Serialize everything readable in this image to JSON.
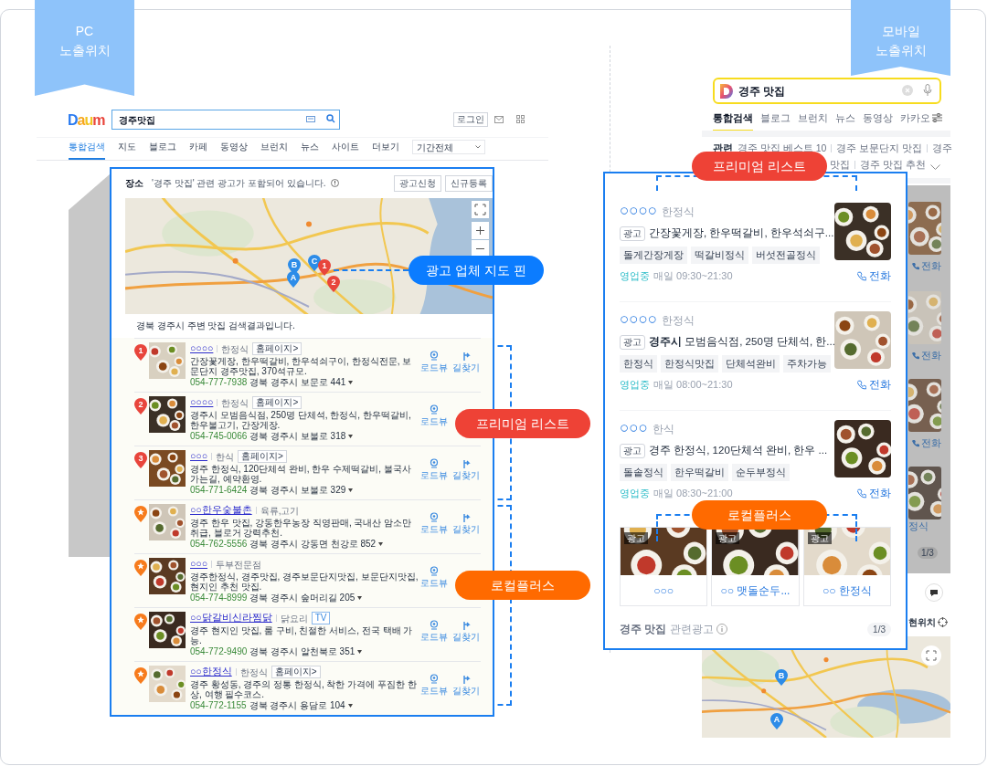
{
  "ribbons": [
    {
      "lines": [
        "PC",
        "노출위치"
      ]
    },
    {
      "lines": [
        "모바일",
        "노출위치"
      ]
    }
  ],
  "pc": {
    "logo": "Daum",
    "search": {
      "value": "경주맛집"
    },
    "login": "로그인",
    "tabs": [
      {
        "label": "통합검색",
        "selected": true
      },
      {
        "label": "지도",
        "selected": false
      },
      {
        "label": "블로그",
        "selected": false
      },
      {
        "label": "카페",
        "selected": false
      },
      {
        "label": "동영상",
        "selected": false
      },
      {
        "label": "브런치",
        "selected": false
      },
      {
        "label": "뉴스",
        "selected": false
      },
      {
        "label": "사이트",
        "selected": false
      },
      {
        "label": "더보기",
        "selected": false
      }
    ],
    "period": "기간전체",
    "place_panel": {
      "title": "장소",
      "notice": "'경주 맛집' 관련 광고가 포함되어 있습니다.",
      "buttons": [
        "광고신청",
        "신규등록"
      ],
      "map": {
        "pins": [
          {
            "label": "B",
            "kind": "ad"
          },
          {
            "label": "A",
            "kind": "ad"
          },
          {
            "label": "C",
            "kind": "ad"
          },
          {
            "label": "1",
            "kind": "premium"
          },
          {
            "label": "2",
            "kind": "premium"
          }
        ]
      },
      "summary": "경북 경주시 주변 맛집 검색결과입니다.",
      "results": [
        {
          "kind": "premium",
          "marker": "1",
          "name": "○○○○",
          "category": "한정식",
          "badge": {
            "kind": "homepage",
            "text": "홈페이지>"
          },
          "description": "간장꽃게장, 한우떡갈비, 한우석쇠구이, 한정식전문, 보문단지 경주맛집, 370석규모.",
          "phone": "054-777-7938",
          "address": "경북 경주시 보문로 441",
          "actions": [
            {
              "kind": "roadview",
              "label": "로드뷰"
            },
            {
              "kind": "directions",
              "label": "길찾기"
            }
          ]
        },
        {
          "kind": "premium",
          "marker": "2",
          "name": "○○○○",
          "category": "한정식",
          "badge": {
            "kind": "homepage",
            "text": "홈페이지>"
          },
          "description": "경주시 모범음식점, 250명 단체석, 한정식, 한우떡갈비, 한우불고기, 간장게장.",
          "phone": "054-745-0066",
          "address": "경북 경주시 보불로 318",
          "actions": [
            {
              "kind": "roadview",
              "label": "로드뷰"
            }
          ]
        },
        {
          "kind": "premium",
          "marker": "3",
          "name": "○○○",
          "category": "한식",
          "badge": {
            "kind": "homepage",
            "text": "홈페이지>"
          },
          "description": "경주 한정식, 120단체석 완비, 한우 수제떡갈비, 불국사 가는길, 예약환영.",
          "phone": "054-771-6424",
          "address": "경북 경주시 보불로 329",
          "actions": [
            {
              "kind": "roadview",
              "label": "로드뷰"
            },
            {
              "kind": "directions",
              "label": "길찾기"
            }
          ]
        },
        {
          "kind": "local",
          "name": "○○한우숯불촌",
          "category": "육류,고기",
          "description": "경주 한우 맛집, 강동한우농장 직영판매, 국내산 암소만 취급, 블로거 강력추천.",
          "phone": "054-762-5556",
          "address": "경북 경주시 강동면 천강로 852",
          "actions": [
            {
              "kind": "roadview",
              "label": "로드뷰"
            },
            {
              "kind": "directions",
              "label": "길찾기"
            }
          ]
        },
        {
          "kind": "local",
          "name": "○○○",
          "category": "두부전문점",
          "description": "경주한정식, 경주맛집, 경주보문단지맛집, 보문단지맛집, 현지인 추천 맛집.",
          "phone": "054-774-8999",
          "address": "경북 경주시 숲머리길 205",
          "actions": [
            {
              "kind": "roadview",
              "label": "로드뷰"
            }
          ]
        },
        {
          "kind": "local",
          "name": "○○닭갈비신라찜닭",
          "category": "닭요리",
          "badge": {
            "kind": "tv",
            "text": "TV"
          },
          "description": "경주 현지인 맛집, 룸 구비, 친절한 서비스, 전국 택배 가능.",
          "phone": "054-772-9490",
          "address": "경북 경주시 알천북로 351",
          "actions": [
            {
              "kind": "roadview",
              "label": "로드뷰"
            },
            {
              "kind": "directions",
              "label": "길찾기"
            }
          ]
        },
        {
          "kind": "local",
          "name": "○○한정식",
          "category": "한정식",
          "badge": {
            "kind": "homepage",
            "text": "홈페이지>"
          },
          "description": "경주 황성동, 경주의 정통 한정식, 착한 가격에 푸짐한 한상, 여행 필수코스.",
          "phone": "054-772-1155",
          "address": "경북 경주시 용담로 104",
          "actions": [
            {
              "kind": "roadview",
              "label": "로드뷰"
            },
            {
              "kind": "directions",
              "label": "길찾기"
            }
          ]
        }
      ]
    },
    "callouts": [
      {
        "label": "광고 업체 지도 핀",
        "color": "#0b7cff"
      },
      {
        "label": "프리미엄 리스트",
        "color": "#ee4236"
      },
      {
        "label": "로컬플러스",
        "color": "#ff6a00"
      }
    ]
  },
  "mobile": {
    "search": {
      "value": "경주 맛집"
    },
    "tabs": [
      {
        "label": "통합검색",
        "selected": true
      },
      {
        "label": "블로그",
        "selected": false
      },
      {
        "label": "브런치",
        "selected": false
      },
      {
        "label": "뉴스",
        "selected": false
      },
      {
        "label": "동영상",
        "selected": false
      },
      {
        "label": "카카오",
        "selected": false
      }
    ],
    "related": {
      "label": "관련",
      "line1": [
        "경주 맛집 베스트 10",
        "경주 보문단지 맛집",
        "경주"
      ],
      "line2": [
        "맛집",
        "경주 맛집 추천"
      ]
    },
    "premium": [
      {
        "name": "○○○○",
        "category": "한정식",
        "ad": "광고",
        "description": "간장꽃게장, 한우떡갈비, 한우석쇠구...",
        "tags": [
          "돌게간장게장",
          "떡갈비정식",
          "버섯전골정식"
        ],
        "status": "영업중",
        "hours": "매일 09:30~21:30",
        "call": "전화"
      },
      {
        "name": "○○○○",
        "category": "한정식",
        "ad": "광고",
        "description": "**경주시** 모범음식점, 250명 단체석, 한...",
        "tags": [
          "한정식",
          "한정식맛집",
          "단체석완비",
          "주차가능"
        ],
        "status": "영업중",
        "hours": "매일 08:00~21:30",
        "call": "전화"
      },
      {
        "name": "○○○",
        "category": "한식",
        "ad": "광고",
        "description": "경주 한정식, 120단체석 완비, 한우 ...",
        "tags": [
          "돌솥정식",
          "한우떡갈비",
          "순두부정식"
        ],
        "status": "영업중",
        "hours": "매일 08:30~21:00",
        "call": "전화"
      }
    ],
    "local_plus": [
      {
        "ad": "광고",
        "name": "○○○"
      },
      {
        "ad": "광고",
        "name": "○○ 맷돌순두..."
      },
      {
        "ad": "광고",
        "name": "○○ 한정식"
      }
    ],
    "footer": {
      "query": "경주 맛집",
      "label": "관련광고",
      "page": "1/3"
    },
    "background_page": {
      "calls": [
        "전화",
        "전화",
        "전화"
      ],
      "cut_text": "정식",
      "page": "1/3",
      "location": "현위치"
    },
    "map": {
      "pins": [
        "B",
        "A"
      ]
    },
    "callouts": [
      {
        "label": "프리미엄 리스트",
        "color": "#ee4236"
      },
      {
        "label": "로컬플러스",
        "color": "#ff6a00"
      }
    ]
  }
}
